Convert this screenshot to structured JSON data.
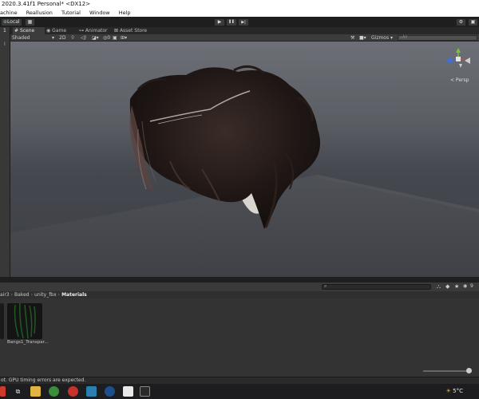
{
  "window": {
    "title": "2020.3.41f1 Personal* <DX12>"
  },
  "menu": {
    "items": [
      "achine",
      "Reallusion",
      "Tutorial",
      "Window",
      "Help"
    ]
  },
  "toolbar": {
    "pivot_label": "Local",
    "layout_glyph": "▦",
    "play_glyph": "▶",
    "pause_glyph": "❚❚",
    "step_glyph": "▶|"
  },
  "left_panel": {
    "value": "1",
    "secondary": "I"
  },
  "tabs": [
    {
      "label": "Scene",
      "icon": "scene-icon"
    },
    {
      "label": "Game",
      "icon": "game-icon"
    },
    {
      "label": "Animator",
      "icon": "animator-icon"
    },
    {
      "label": "Asset Store",
      "icon": "store-icon"
    }
  ],
  "scene_toolbar": {
    "shading_mode": "Shaded",
    "mode_2d": "2D",
    "hidden_count": "0",
    "gizmos_label": "Gizmos",
    "search_placeholder": "All"
  },
  "viewport": {
    "persp_label": "< Persp"
  },
  "project": {
    "breadcrumb": [
      "air3",
      "Baked",
      "unity_fbx",
      "Materials"
    ],
    "hidden_count": "9",
    "assets": [
      {
        "label": "Bangs1_Transpar..."
      }
    ]
  },
  "status": {
    "message": "ot. GPU timing errors are expected."
  },
  "taskbar": {
    "temperature": "5°C"
  },
  "colors": {
    "title_bg": "#ffffff",
    "editor_bg": "#282828",
    "panel_bg": "#3c3c3c",
    "taskbar_bg": "#1d1d1f"
  }
}
